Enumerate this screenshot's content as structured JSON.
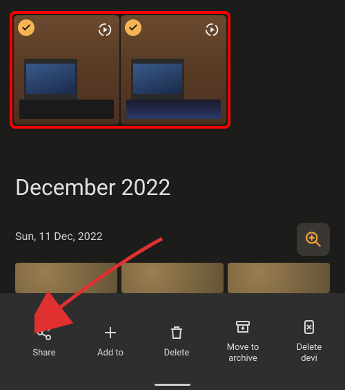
{
  "selectedPhotos": {
    "highlighted": true,
    "items": [
      {
        "selected": true,
        "hasMotion": true
      },
      {
        "selected": true,
        "hasMotion": true
      }
    ]
  },
  "monthTitle": "December 2022",
  "dateLabel": "Sun, 11 Dec, 2022",
  "zoom": {
    "iconName": "zoom-in"
  },
  "actions": [
    {
      "icon": "share",
      "label": "Share"
    },
    {
      "icon": "plus",
      "label": "Add to"
    },
    {
      "icon": "trash",
      "label": "Delete"
    },
    {
      "icon": "archive",
      "label": "Move to\narchive"
    },
    {
      "icon": "deleteDevice",
      "label": "Delete\ndevi"
    }
  ],
  "colors": {
    "checkBadge": "#f5b553",
    "highlight": "#ff0000",
    "zoomIcon": "#f0a838"
  }
}
